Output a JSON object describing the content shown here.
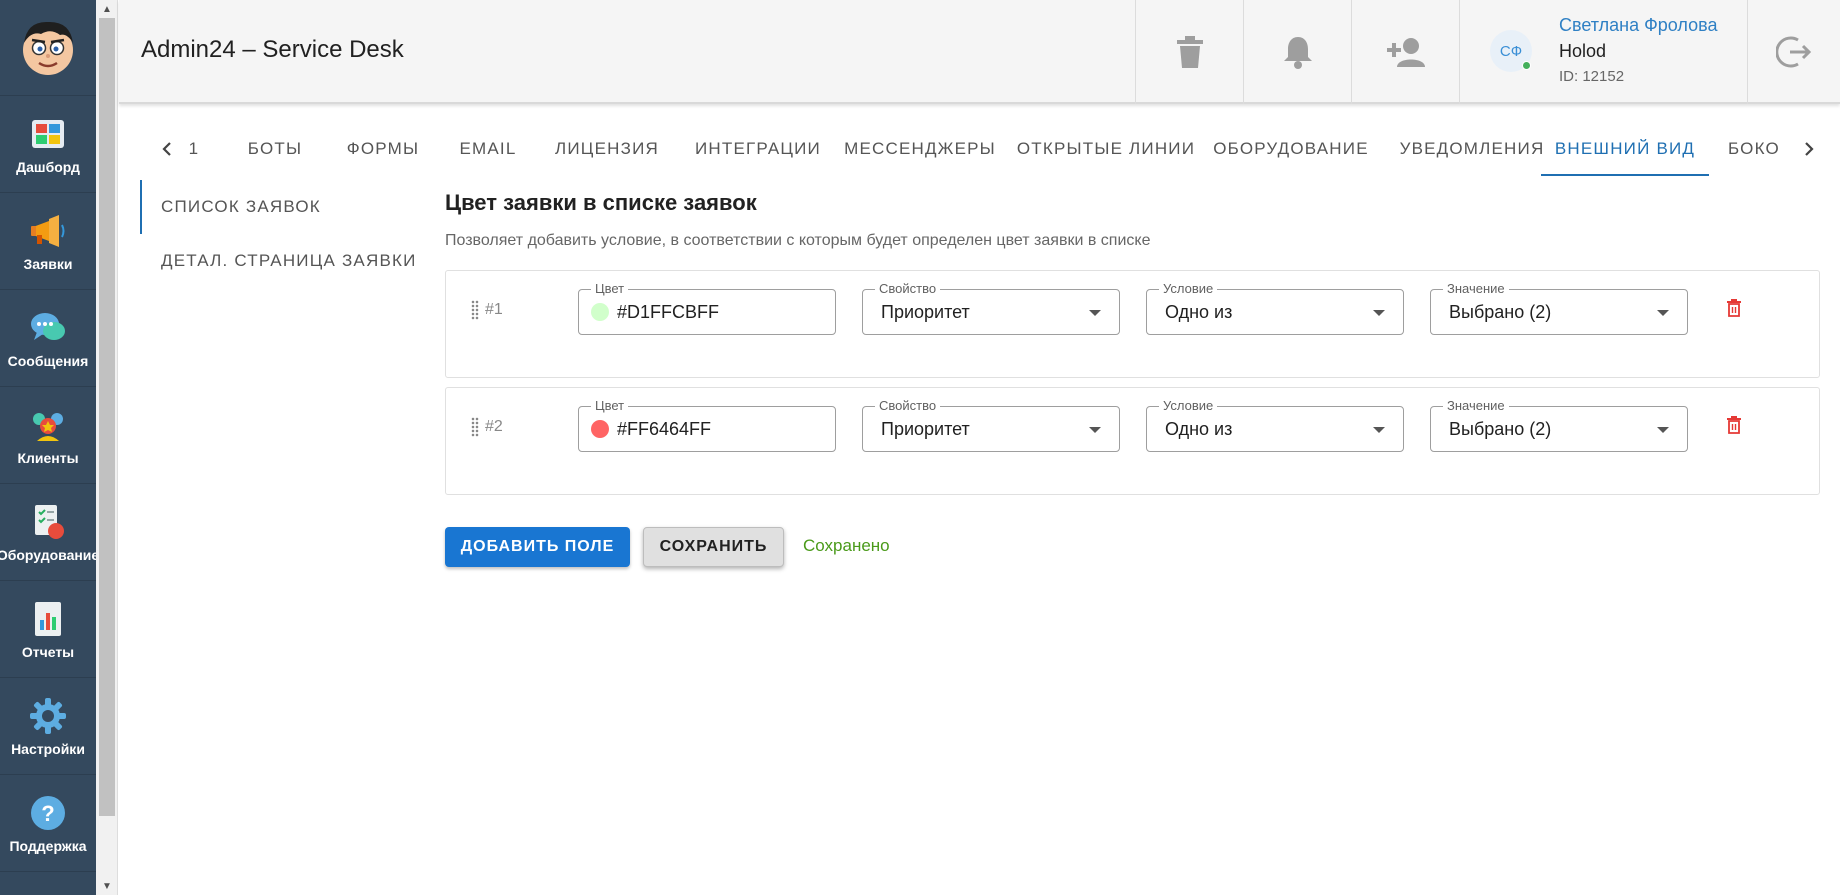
{
  "nav": {
    "items": [
      {
        "label": "Дашборд",
        "icon": "dashboard-icon"
      },
      {
        "label": "Заявки",
        "icon": "megaphone-icon"
      },
      {
        "label": "Сообщения",
        "icon": "chat-bubbles-icon"
      },
      {
        "label": "Клиенты",
        "icon": "clients-icon"
      },
      {
        "label": "Оборудование",
        "icon": "equipment-icon"
      },
      {
        "label": "Отчеты",
        "icon": "reports-icon"
      },
      {
        "label": "Настройки",
        "icon": "gear-icon"
      },
      {
        "label": "Поддержка",
        "icon": "help-icon"
      }
    ]
  },
  "header": {
    "title": "Admin24 – Service Desk",
    "actions": [
      "trash-icon",
      "bell-icon",
      "add-user-icon"
    ],
    "user": {
      "initials": "СФ",
      "name": "Светлана Фролова",
      "company": "Holod",
      "id": "ID: 12152",
      "status_color": "#43b05c"
    }
  },
  "tabs": {
    "items": [
      "1",
      "БОТЫ",
      "ФОРМЫ",
      "EMAIL",
      "ЛИЦЕНЗИЯ",
      "ИНТЕГРАЦИИ",
      "МЕССЕНДЖЕРЫ",
      "ОТКРЫТЫЕ ЛИНИИ",
      "ОБОРУДОВАНИЕ",
      "УВЕДОМЛЕНИЯ",
      "ВНЕШНИЙ ВИД",
      "БОКО"
    ],
    "active": "ВНЕШНИЙ ВИД"
  },
  "subnav": {
    "items": [
      "СПИСОК ЗАЯВОК",
      "ДЕТАЛ. СТРАНИЦА ЗАЯВКИ"
    ],
    "active": "СПИСОК ЗАЯВОК"
  },
  "main": {
    "title": "Цвет заявки в списке заявок",
    "description": "Позволяет добавить условие, в соответствии с которым будет определен цвет заявки в списке",
    "field_labels": {
      "color": "Цвет",
      "property": "Свойство",
      "condition": "Условие",
      "value": "Значение"
    },
    "rules": [
      {
        "index": "#1",
        "color": "#D1FFCBFF",
        "swatch": "#d1ffcb",
        "property": "Приоритет",
        "condition": "Одно из",
        "value": "Выбрано (2)"
      },
      {
        "index": "#2",
        "color": "#FF6464FF",
        "swatch": "#ff6464",
        "property": "Приоритет",
        "condition": "Одно из",
        "value": "Выбрано (2)"
      }
    ],
    "add_button": "ДОБАВИТЬ ПОЛЕ",
    "save_button": "СОХРАНИТЬ",
    "saved_status": "Сохранено"
  },
  "colors": {
    "accent": "#1976d2",
    "sidebar": "#34495e",
    "delete": "#e53935",
    "success": "#4a9a1a"
  }
}
